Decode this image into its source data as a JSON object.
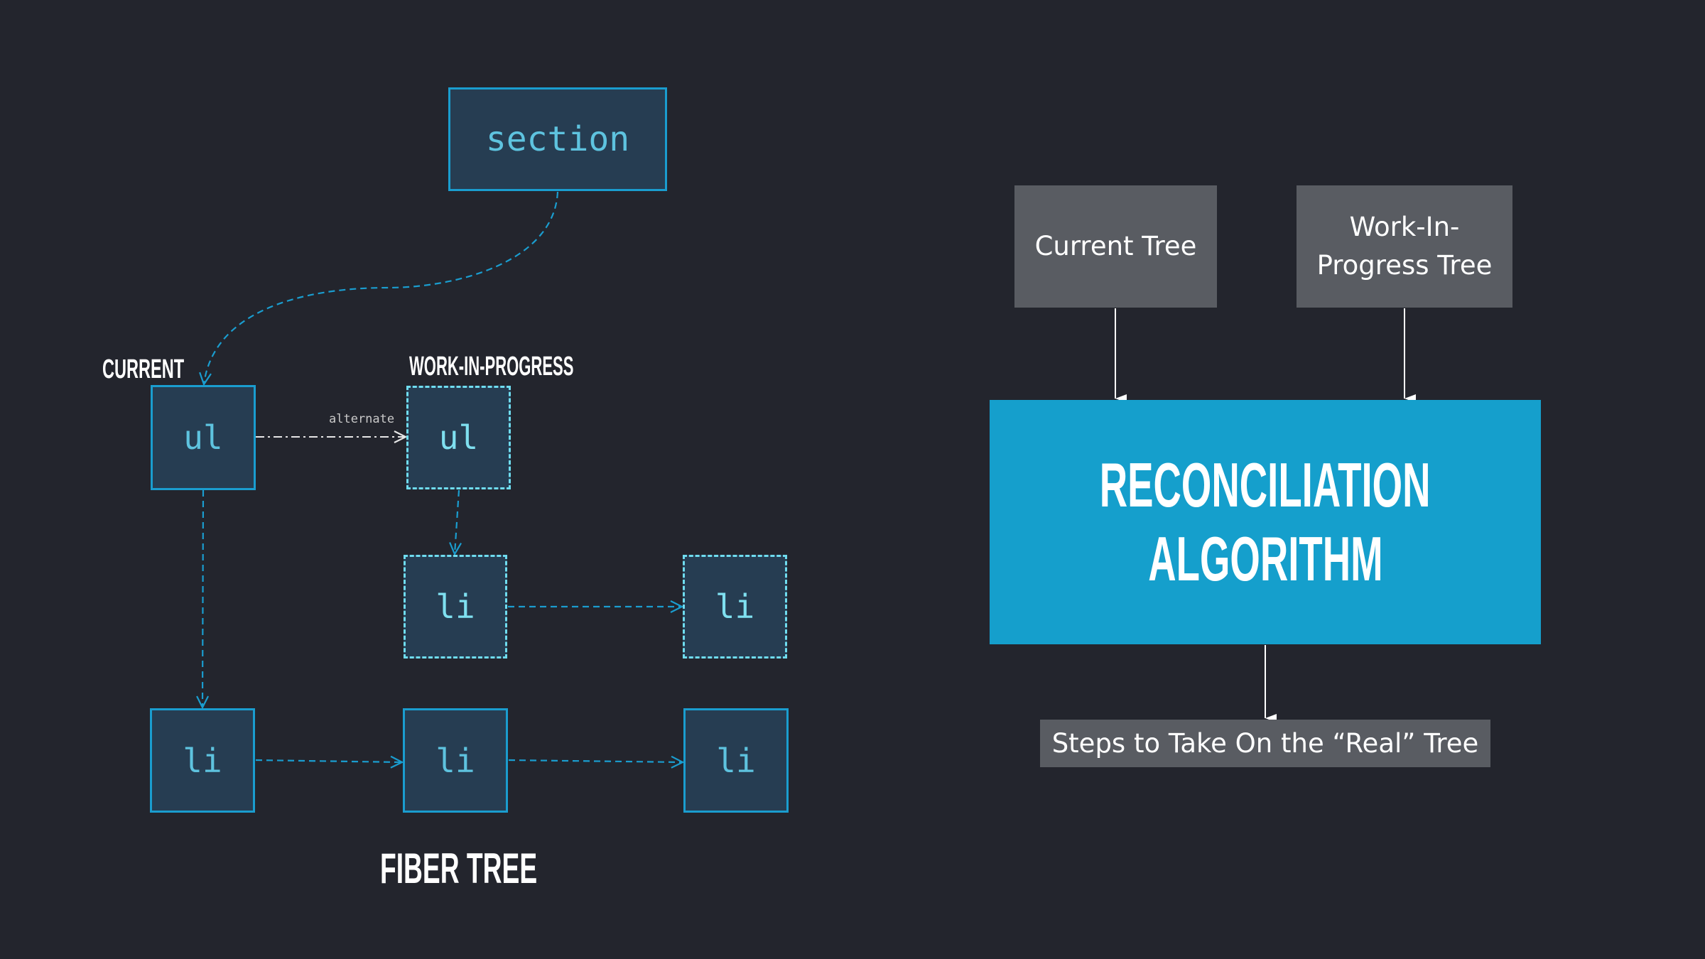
{
  "fiber_tree": {
    "title": "FIBER TREE",
    "labels": {
      "current": "CURRENT",
      "work_in_progress": "WORK-IN-PROGRESS",
      "alternate": "alternate"
    },
    "nodes": {
      "root": "section",
      "current_ul": "ul",
      "wip_ul": "ul",
      "wip_li_1": "li",
      "wip_li_2": "li",
      "current_li_1": "li",
      "current_li_2": "li",
      "current_li_3": "li"
    },
    "colors": {
      "node_border": "#1a9dcf",
      "wip_border": "#6fdcef",
      "node_fill": "#263d52",
      "edge": "#1a9dcf",
      "alternate_edge": "#c9c9c9"
    }
  },
  "reconciliation": {
    "inputs": [
      "Current Tree",
      "Work-In-Progress Tree"
    ],
    "input_lines": [
      [
        "Current Tree"
      ],
      [
        "Work-In-",
        "Progress Tree"
      ]
    ],
    "algorithm": [
      "RECONCILIATION",
      "ALGORITHM"
    ],
    "output": "Steps to Take On the “Real” Tree",
    "colors": {
      "algorithm_fill": "#159fcc",
      "box_fill": "#595c62",
      "background": "#23252d"
    }
  }
}
